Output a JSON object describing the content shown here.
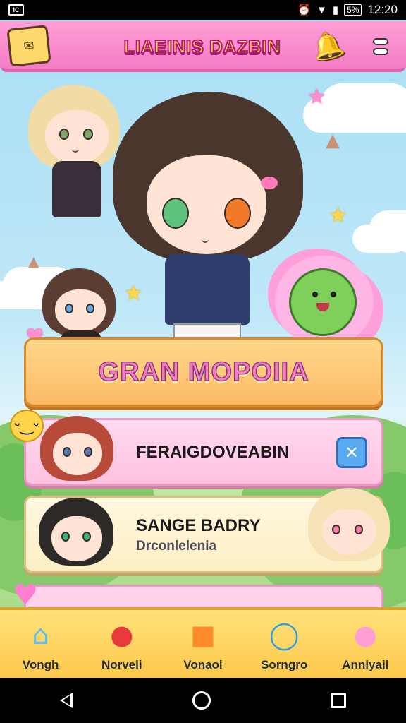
{
  "status_bar": {
    "time": "12:20",
    "battery": "5%",
    "left_icon": "notification-icon",
    "icons": [
      "alarm-icon",
      "wifi-icon",
      "signal-icon"
    ]
  },
  "header": {
    "title": "LIAEINIS DAZBIN",
    "left_icon": "scroll-icon",
    "bell_icon": "bell-icon",
    "menu_icon": "menu-icon"
  },
  "main_banner": {
    "label": "GRAN MOPOIIA"
  },
  "cards": [
    {
      "title": "FERAIGDOVEABIN",
      "action_icon": "close-icon"
    },
    {
      "title": "SANGE BADRY",
      "subtitle": "Drconlelenia"
    },
    {
      "title": ""
    }
  ],
  "bottom_nav": [
    {
      "label": "Vongh",
      "icon": "house-icon",
      "glyph": "⌂"
    },
    {
      "label": "Norveli",
      "icon": "tomato-icon",
      "glyph": "●"
    },
    {
      "label": "Vonaoi",
      "icon": "box-icon",
      "glyph": "■"
    },
    {
      "label": "Sorngro",
      "icon": "ring-icon",
      "glyph": "◯"
    },
    {
      "label": "Anniyail",
      "icon": "pig-icon",
      "glyph": "●"
    }
  ],
  "colors": {
    "header_pink": "#f47cc4",
    "title_yellow": "#ffe33a",
    "banner_orange": "#fcb964",
    "nav_yellow": "#fcc84a",
    "close_blue": "#5aaaf0"
  }
}
